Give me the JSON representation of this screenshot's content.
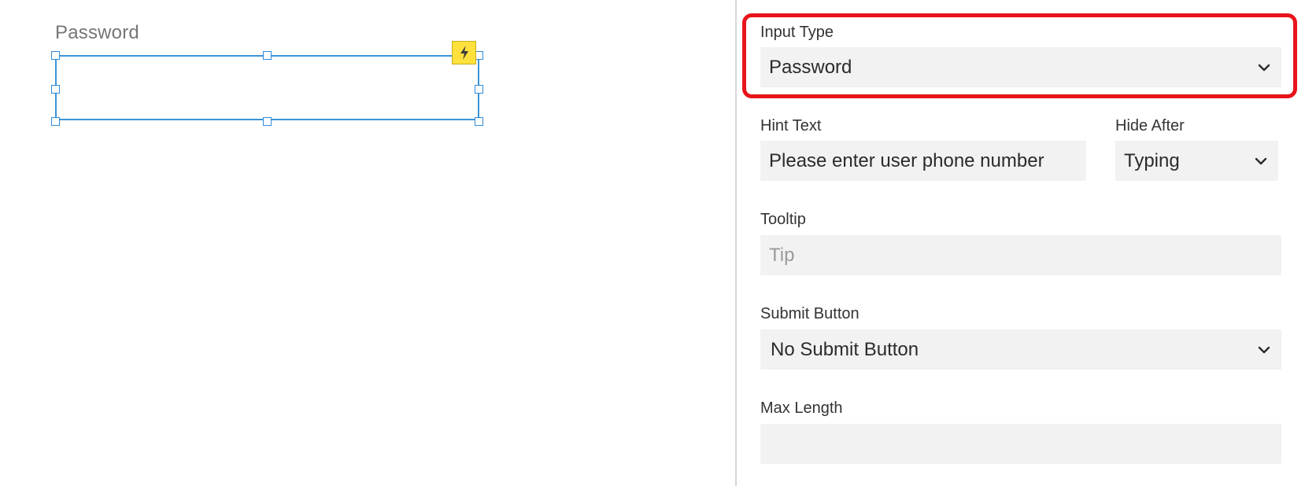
{
  "canvas": {
    "widget_label": "Password"
  },
  "panel": {
    "input_type": {
      "label": "Input Type",
      "value": "Password"
    },
    "hint_text": {
      "label": "Hint Text",
      "value": "Please enter user phone number"
    },
    "hide_after": {
      "label": "Hide After",
      "value": "Typing"
    },
    "tooltip": {
      "label": "Tooltip",
      "placeholder": "Tip"
    },
    "submit_button": {
      "label": "Submit Button",
      "value": "No Submit Button"
    },
    "max_length": {
      "label": "Max Length",
      "value": ""
    }
  },
  "colors": {
    "selection": "#3b95d9",
    "highlight": "#e8141b",
    "badge": "#ffe03d",
    "field_bg": "#f2f2f2"
  },
  "icons": {
    "badge": "lightning-bolt-icon",
    "dropdown": "chevron-down-icon"
  }
}
